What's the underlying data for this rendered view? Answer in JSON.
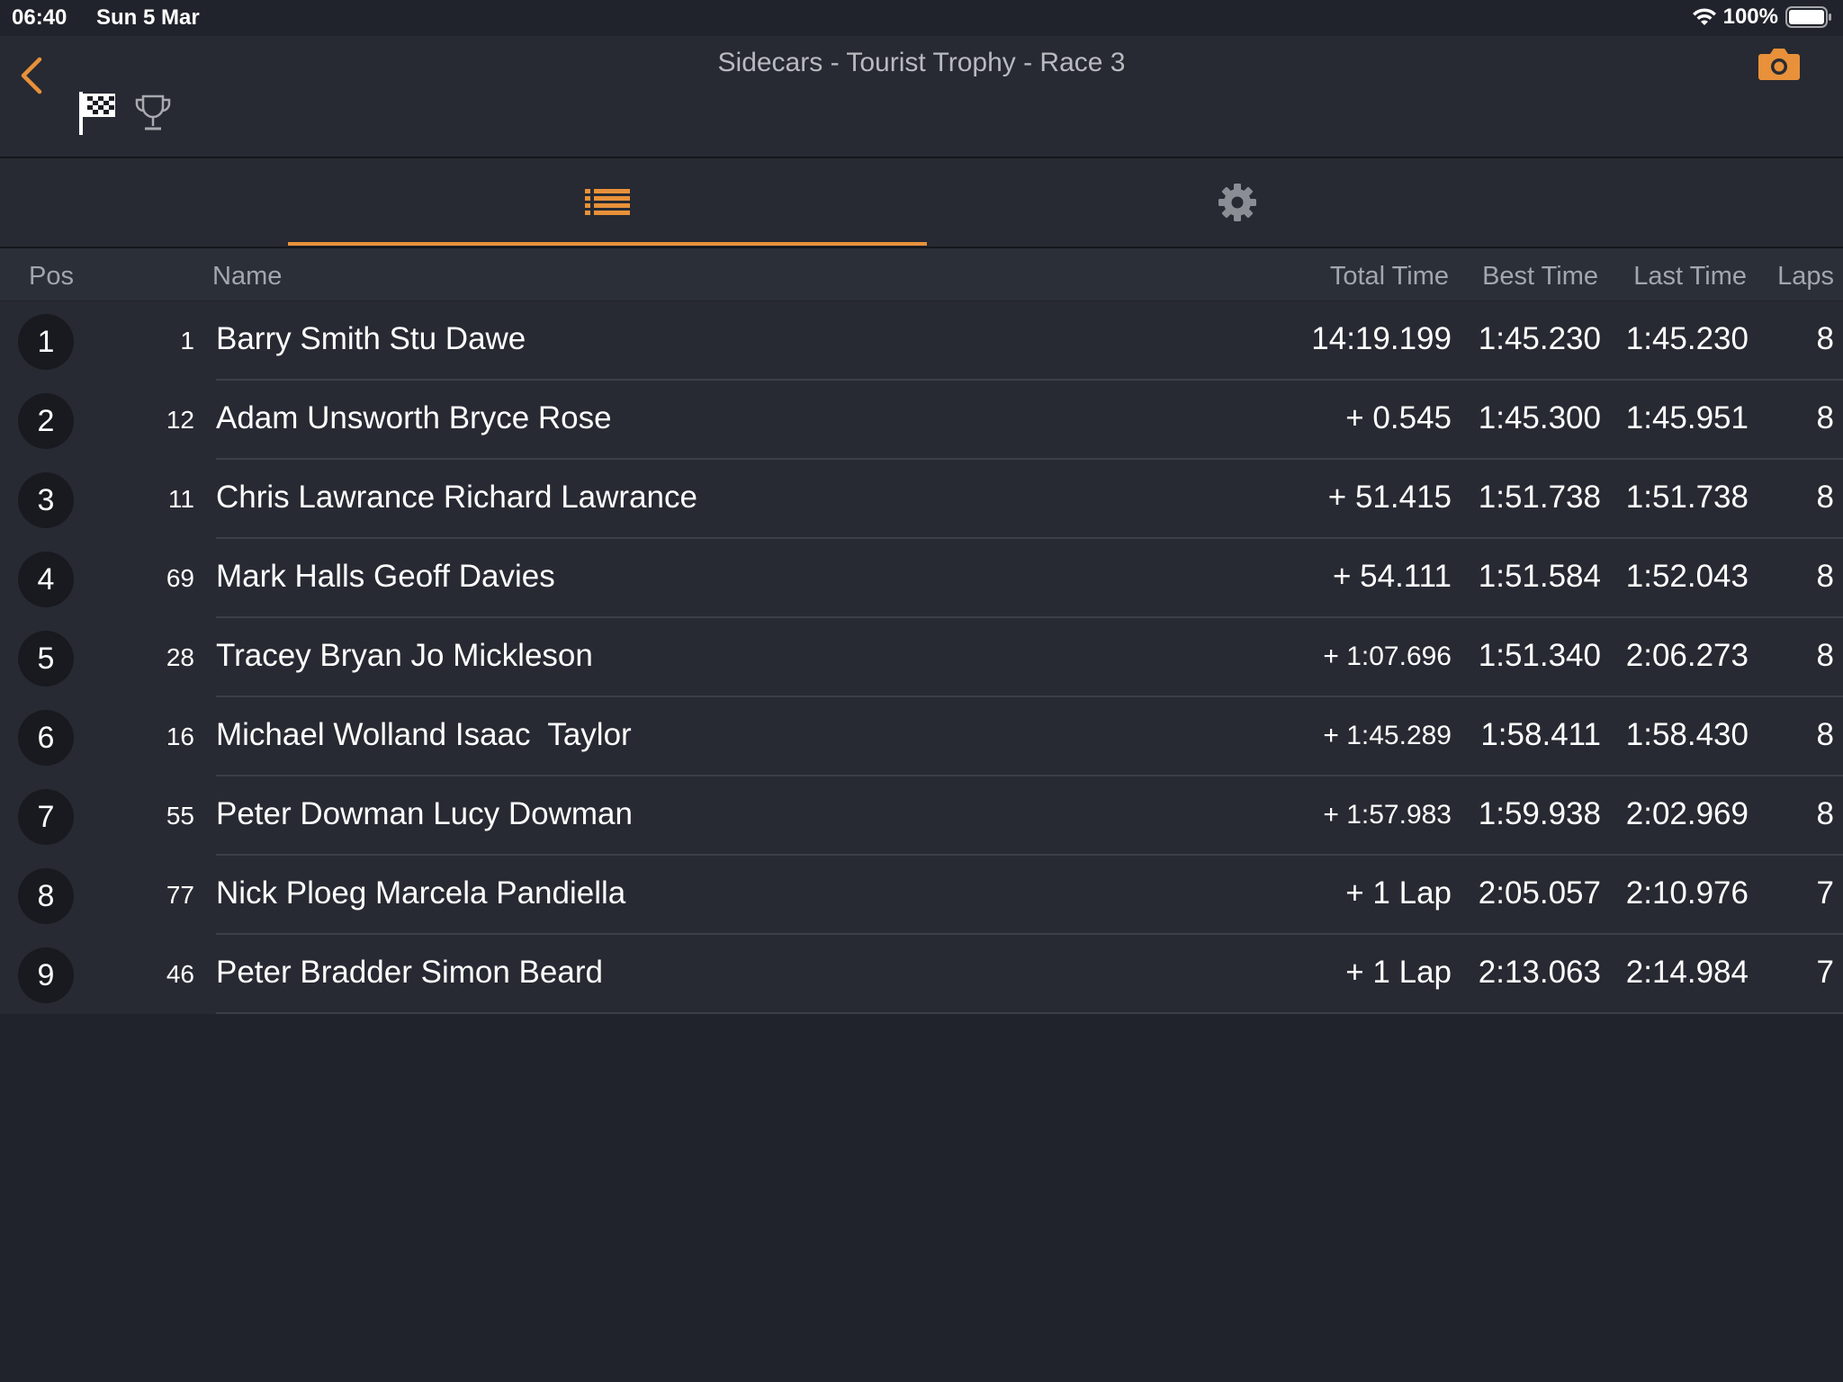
{
  "status_bar": {
    "time": "06:40",
    "date": "Sun 5 Mar",
    "battery": "100%",
    "wifi_icon": "wifi-icon",
    "battery_icon": "battery-icon"
  },
  "header": {
    "title": "Sidecars - Tourist Trophy - Race 3",
    "back_icon": "chevron-left-icon",
    "flag_icon": "checkered-flag-icon",
    "trophy_icon": "trophy-icon",
    "camera_icon": "camera-icon"
  },
  "tabs": [
    {
      "icon": "list-icon",
      "selected": true
    },
    {
      "icon": "gear-icon",
      "selected": false
    }
  ],
  "colors": {
    "accent": "#e8913a",
    "background": "#20232b",
    "row_background": "#272a32",
    "header_background": "#2b2f38"
  },
  "table": {
    "columns": {
      "pos": "Pos",
      "name": "Name",
      "total_time": "Total Time",
      "best_time": "Best Time",
      "last_time": "Last Time",
      "laps": "Laps"
    },
    "rows": [
      {
        "pos": "1",
        "number": "1",
        "name": "Barry Smith Stu Dawe",
        "total_time": "14:19.199",
        "best_time": "1:45.230",
        "last_time": "1:45.230",
        "laps": "8"
      },
      {
        "pos": "2",
        "number": "12",
        "name": "Adam Unsworth Bryce Rose",
        "total_time": "+ 0.545",
        "best_time": "1:45.300",
        "last_time": "1:45.951",
        "laps": "8"
      },
      {
        "pos": "3",
        "number": "11",
        "name": "Chris Lawrance Richard Lawrance",
        "total_time": "+ 51.415",
        "best_time": "1:51.738",
        "last_time": "1:51.738",
        "laps": "8"
      },
      {
        "pos": "4",
        "number": "69",
        "name": "Mark Halls Geoff Davies",
        "total_time": "+ 54.111",
        "best_time": "1:51.584",
        "last_time": "1:52.043",
        "laps": "8"
      },
      {
        "pos": "5",
        "number": "28",
        "name": "Tracey Bryan Jo Mickleson",
        "total_time": "+ 1:07.696",
        "best_time": "1:51.340",
        "last_time": "2:06.273",
        "laps": "8"
      },
      {
        "pos": "6",
        "number": "16",
        "name": "Michael Wolland Isaac  Taylor",
        "total_time": "+ 1:45.289",
        "best_time": "1:58.411",
        "last_time": "1:58.430",
        "laps": "8"
      },
      {
        "pos": "7",
        "number": "55",
        "name": "Peter Dowman Lucy Dowman",
        "total_time": "+ 1:57.983",
        "best_time": "1:59.938",
        "last_time": "2:02.969",
        "laps": "8"
      },
      {
        "pos": "8",
        "number": "77",
        "name": "Nick Ploeg Marcela Pandiella",
        "total_time": "+ 1 Lap",
        "best_time": "2:05.057",
        "last_time": "2:10.976",
        "laps": "7"
      },
      {
        "pos": "9",
        "number": "46",
        "name": "Peter Bradder Simon Beard",
        "total_time": "+ 1 Lap",
        "best_time": "2:13.063",
        "last_time": "2:14.984",
        "laps": "7"
      }
    ]
  }
}
